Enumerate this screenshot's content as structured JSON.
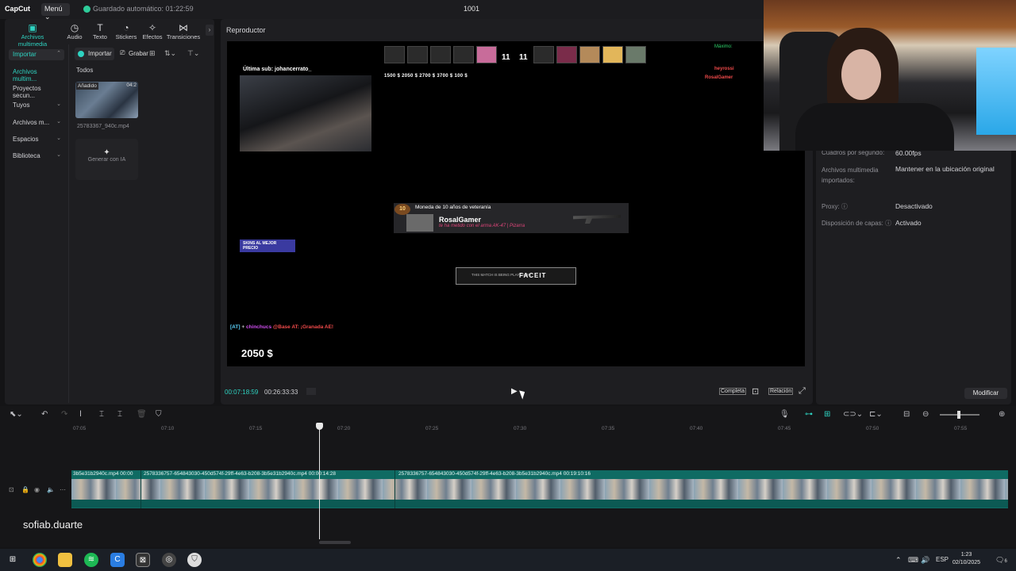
{
  "app": {
    "logo": "CapCut",
    "menu_label": "Menú",
    "autosave": "Guardado automático: 01:22:59",
    "project_title": "1001"
  },
  "top_tabs": [
    {
      "label": "Archivos multimedia",
      "icon": "media-icon"
    },
    {
      "label": "Audio",
      "icon": "audio-icon"
    },
    {
      "label": "Texto",
      "icon": "text-icon"
    },
    {
      "label": "Stickers",
      "icon": "sticker-icon"
    },
    {
      "label": "Efectos",
      "icon": "effects-icon"
    },
    {
      "label": "Transiciones",
      "icon": "transitions-icon"
    }
  ],
  "sidebar": {
    "items": [
      {
        "label": "Importar"
      },
      {
        "label": "Archivos multim..."
      },
      {
        "label": "Proyectos secun..."
      },
      {
        "label": "Tuyos"
      },
      {
        "label": "Archivos m..."
      },
      {
        "label": "Espacios"
      },
      {
        "label": "Biblioteca"
      }
    ]
  },
  "media": {
    "import_label": "Importar",
    "record_label": "Grabar",
    "filter_label": "Todos",
    "thumb_badge": "Añadido",
    "thumb_duration": "04:2",
    "thumb_name": "25783367_940c.mp4",
    "ai_label": "Generar con IA"
  },
  "player": {
    "title": "Reproductor",
    "current_time": "00:07:18:59",
    "total_time": "00:26:33:33",
    "full_label": "Completa",
    "ratio_label": "Relación"
  },
  "stream": {
    "last_sub": "Última sub: johancerrato_",
    "score_a": "11",
    "score_b": "11",
    "money_row": "1500 $    2050 $    2700 $    3700 $    100 $",
    "max_label": "Máximo:",
    "kill_1": "heyrossi",
    "kill_2": "RosalGamer",
    "vet_level": "10",
    "vet_title": "Moneda de 10 años de veteranía",
    "vet_player": "RosalGamer",
    "vet_weapon": "te ha metido con el arma AK-47 | Pizarra",
    "skins_label": "SKINS AL MEJOR PRECIO",
    "faceit_small": "THIS MATCH IS BEING PLAYED ON",
    "faceit_logo": "FACEIT",
    "chat_tag": "[AT]",
    "chat_user": "chinchucs",
    "chat_msg": "@Base AT: ¡Granada AE!",
    "money": "2050 $"
  },
  "properties": {
    "rows": [
      {
        "label": "Cuadros por segundo:",
        "value": "60.00fps"
      },
      {
        "label": "Archivos multimedia importados:",
        "value": "Mantener en la ubicación original"
      },
      {
        "label": "Proxy:",
        "value": "Desactivado"
      },
      {
        "label": "Disposición de capas:",
        "value": "Activado"
      }
    ],
    "modify_label": "Modificar"
  },
  "timeline": {
    "ruler": [
      "07:05",
      "07:10",
      "07:15",
      "07:20",
      "07:25",
      "07:30",
      "07:35",
      "07:40",
      "07:45",
      "07:50",
      "07:55"
    ],
    "clips": [
      {
        "name": "3b5e31b2940c.mp4  00:00"
      },
      {
        "name": "2578336757-654843030-450d574f-29ff-4e63-b208-3b5e31b2940c.mp4  00:00:14:28"
      },
      {
        "name": "2578336757-654843030-450d574f-29ff-4e63-b208-3b5e31b2940c.mp4  00:19:10:16"
      }
    ]
  },
  "overlay": {
    "streamer_name": "sofiab.duarte"
  },
  "taskbar": {
    "lang": "ESP",
    "time": "1:23",
    "date": "02/10/2025",
    "notif_count": "6"
  }
}
